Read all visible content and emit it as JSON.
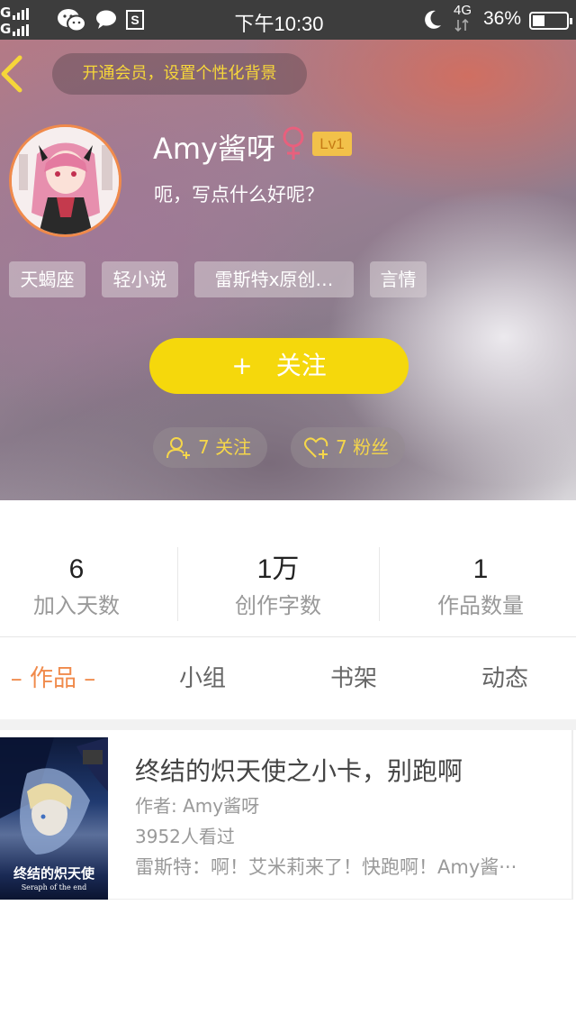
{
  "status_bar": {
    "signal_1": "G",
    "signal_2": "G",
    "time": "下午10:30",
    "network": "4G",
    "battery_percent": "36%",
    "battery_level": 0.36
  },
  "header": {
    "vip_banner": "开通会员，设置个性化背景",
    "username": "Amy酱呀",
    "level": "Lv1",
    "bio": "呃，写点什么好呢？",
    "tags": [
      "天蝎座",
      "轻小说",
      "雷斯特x原创…",
      "言情"
    ],
    "follow_button": {
      "plus": "+",
      "label": "关注"
    },
    "following": "7 关注",
    "fans": "7 粉丝"
  },
  "stats": [
    {
      "value": "6",
      "label": "加入天数"
    },
    {
      "value": "1万",
      "label": "创作字数"
    },
    {
      "value": "1",
      "label": "作品数量"
    }
  ],
  "tabs": {
    "active": "– 作品 –",
    "items": [
      "小组",
      "书架",
      "动态"
    ]
  },
  "work": {
    "cover_title": "终结的炽天使",
    "cover_subtitle": "Seraph of the end",
    "title": "终结的炽天使之小卡，别跑啊",
    "author": "作者: Amy酱呀",
    "views": "3952人看过",
    "excerpt": "雷斯特：啊！艾米莉来了！快跑啊！Amy酱···"
  },
  "colors": {
    "accent_orange": "#f08a4b",
    "follow_yellow": "#f5d80c",
    "vip_text": "#f6d63a",
    "gender_pink": "#e8607d",
    "level_badge": "#f2c14a"
  }
}
